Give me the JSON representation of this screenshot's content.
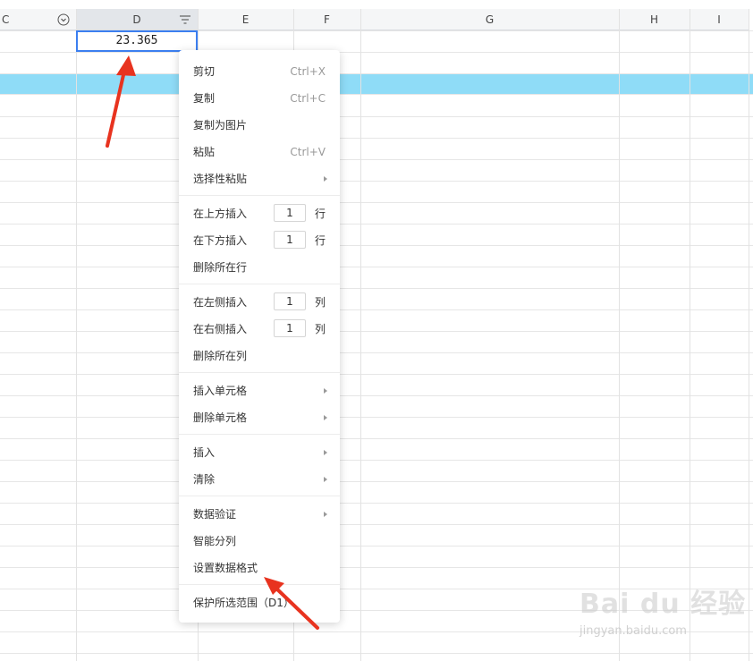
{
  "columns": [
    "C",
    "D",
    "E",
    "F",
    "G",
    "H",
    "I"
  ],
  "selected_cell": {
    "value": "23.365"
  },
  "colors": {
    "highlight_row": "#8fdcf7",
    "selection_border": "#3c7ff0",
    "annotation_arrow": "#e8331f"
  },
  "context_menu": {
    "cut": {
      "label": "剪切",
      "shortcut": "Ctrl+X"
    },
    "copy": {
      "label": "复制",
      "shortcut": "Ctrl+C"
    },
    "copy_as_image": {
      "label": "复制为图片"
    },
    "paste": {
      "label": "粘贴",
      "shortcut": "Ctrl+V"
    },
    "paste_special": {
      "label": "选择性粘贴"
    },
    "insert_above": {
      "label": "在上方插入",
      "count": "1",
      "unit": "行"
    },
    "insert_below": {
      "label": "在下方插入",
      "count": "1",
      "unit": "行"
    },
    "delete_row": {
      "label": "删除所在行"
    },
    "insert_left": {
      "label": "在左侧插入",
      "count": "1",
      "unit": "列"
    },
    "insert_right": {
      "label": "在右侧插入",
      "count": "1",
      "unit": "列"
    },
    "delete_column": {
      "label": "删除所在列"
    },
    "insert_cells": {
      "label": "插入单元格"
    },
    "delete_cells": {
      "label": "删除单元格"
    },
    "insert": {
      "label": "插入"
    },
    "clear": {
      "label": "清除"
    },
    "data_validation": {
      "label": "数据验证"
    },
    "smart_split": {
      "label": "智能分列"
    },
    "set_data_format": {
      "label": "设置数据格式"
    },
    "protect_range": {
      "label": "保护所选范围（D1）"
    }
  },
  "watermark": {
    "text": "Bai du 经验",
    "url": "jingyan.baidu.com"
  }
}
